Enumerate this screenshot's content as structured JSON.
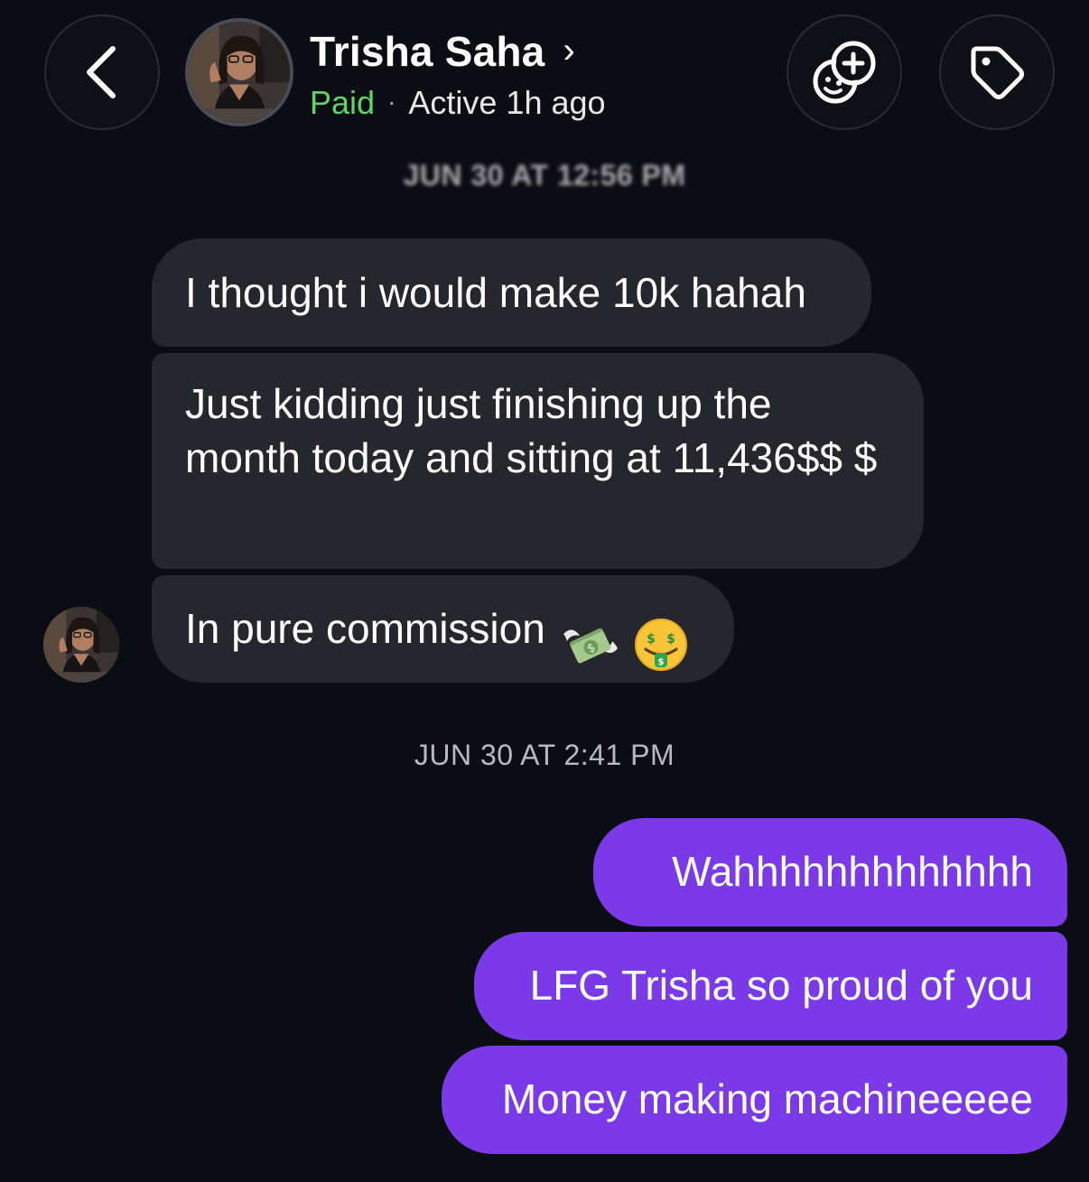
{
  "header": {
    "contact_name": "Trisha Saha",
    "name_chevron": "›",
    "subscription_status": "Paid",
    "separator": "·",
    "activity": "Active 1h ago",
    "icons": {
      "back": "chevron-left-icon",
      "effects": "add-face-icon",
      "tag": "tag-icon"
    }
  },
  "colors": {
    "background": "#0c0d12",
    "incoming_bubble": "#26272c",
    "outgoing_bubble": "#7a3ae8",
    "paid_status": "#5fd46a"
  },
  "conversation": {
    "timestamps": [
      "JUN 30 AT 12:56 PM",
      "JUN 30 AT 2:41 PM"
    ],
    "incoming_messages": [
      {
        "text": "I thought i would make 10k hahah"
      },
      {
        "text": "Just kidding just finishing up the month today and sitting at 11,436$$ $"
      },
      {
        "text": "In pure commission",
        "emojis": [
          "money-with-wings-icon",
          "money-mouth-face-icon"
        ]
      }
    ],
    "outgoing_messages": [
      {
        "text": "Wahhhhhhhhhhhhh"
      },
      {
        "text": "LFG Trisha so proud of you"
      },
      {
        "text": "Money making machineeeee"
      }
    ]
  }
}
